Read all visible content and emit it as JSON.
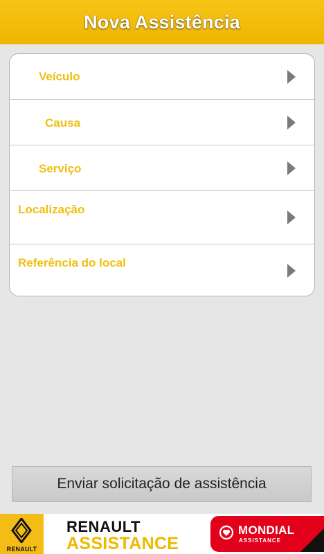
{
  "header": {
    "title": "Nova Assistência"
  },
  "menu": {
    "items": [
      {
        "label": "Veículo",
        "icon": "chevron-right-icon"
      },
      {
        "label": "Causa",
        "icon": "chevron-right-icon"
      },
      {
        "label": "Serviço",
        "icon": "chevron-right-icon"
      },
      {
        "label": "Localização",
        "icon": "chevron-right-icon"
      },
      {
        "label": "Referência do local",
        "icon": "chevron-right-icon"
      }
    ]
  },
  "actions": {
    "send_label": "Enviar solicitação de assistência"
  },
  "footer": {
    "renault_logo_text": "RENAULT",
    "brand_line1": "RENAULT",
    "brand_line2": "ASSISTANCE",
    "partner_name": "MONDIAL",
    "partner_sub": "ASSISTANCE"
  },
  "colors": {
    "accent": "#f0b500",
    "label": "#f0bf10",
    "chevron": "#7a7a7a",
    "partner_red": "#e3001b"
  }
}
